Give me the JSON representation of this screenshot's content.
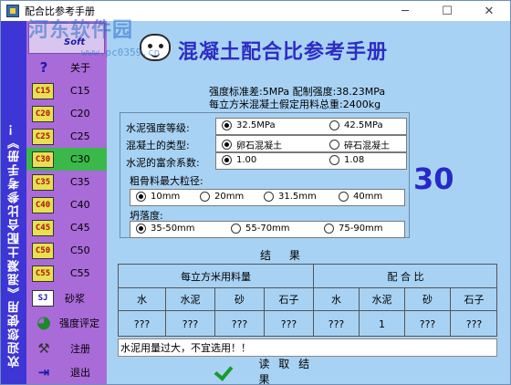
{
  "window": {
    "title": "配合比参考手册",
    "min": "─",
    "max": "☐",
    "close": "✕"
  },
  "watermark": {
    "line1": "河东软件园",
    "line2": "www.pc0359.cn"
  },
  "banner": {
    "text": "欢迎您使用《混凝土配合比参考手册》！"
  },
  "logo": {
    "sub": "Soft"
  },
  "menu": [
    {
      "icon": "?",
      "label": "关于"
    },
    {
      "icon": "C15",
      "label": "C15"
    },
    {
      "icon": "C20",
      "label": "C20"
    },
    {
      "icon": "C25",
      "label": "C25"
    },
    {
      "icon": "C30",
      "label": "C30"
    },
    {
      "icon": "C35",
      "label": "C35"
    },
    {
      "icon": "C40",
      "label": "C40"
    },
    {
      "icon": "C45",
      "label": "C45"
    },
    {
      "icon": "C50",
      "label": "C50"
    },
    {
      "icon": "C55",
      "label": "C55"
    },
    {
      "icon": "SJ",
      "label": "砂浆"
    },
    {
      "icon": "◕",
      "label": "强度评定"
    },
    {
      "icon": "⚒",
      "label": "注册"
    },
    {
      "icon": "⇥",
      "label": "退出"
    }
  ],
  "header": {
    "title": "混凝土配合比参考手册"
  },
  "standard": {
    "line1": "强度标准差:5MPa  配制强度:38.23MPa",
    "line2": "每立方米混凝土假定用料总重:2400kg"
  },
  "params": {
    "cement_grade": {
      "label": "水泥强度等级:",
      "options": [
        "32.5MPa",
        "42.5MPa"
      ]
    },
    "concrete_type": {
      "label": "混凝土的类型:",
      "options": [
        "卵石混凝土",
        "碎石混凝土"
      ]
    },
    "rich_coef": {
      "label": "水泥的富余系数:",
      "options": [
        "1.00",
        "1.08"
      ]
    },
    "aggregate": {
      "label": "粗骨料最大粒径:",
      "options": [
        "10mm",
        "20mm",
        "31.5mm",
        "40mm"
      ]
    },
    "slump": {
      "label": "坍落度:",
      "options": [
        "35-50mm",
        "55-70mm",
        "75-90mm"
      ]
    }
  },
  "grade_display": "30",
  "result": {
    "title": "结 果",
    "group1": "每立方米用料量",
    "group2": "配 合 比",
    "cols": [
      "水",
      "水泥",
      "砂",
      "石子",
      "水",
      "水泥",
      "砂",
      "石子"
    ],
    "values": [
      "???",
      "???",
      "???",
      "???",
      "???",
      "1",
      "???",
      "???"
    ]
  },
  "message": "水泥用量过大，不宜选用！！",
  "read_button": "读 取 结 果"
}
